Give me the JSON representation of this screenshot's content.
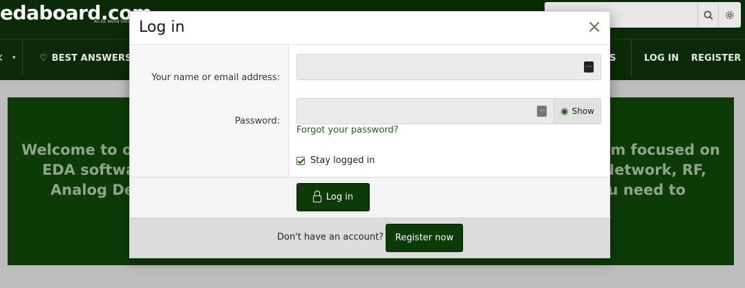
{
  "site": {
    "logo_text": "edaboard.com",
    "logo_tagline": "An EE World Online"
  },
  "header": {
    "search_icon": "search-icon",
    "settings_icon": "gear-icon"
  },
  "nav": {
    "back_glyph": "‹",
    "best_answers": "BEST ANSWERS",
    "dots": "S",
    "login": "LOG IN",
    "register": "REGISTER"
  },
  "welcome": {
    "line1_left": "Welcome to ou",
    "line1_right": "rum focused on",
    "line2_left": "EDA softwa",
    "line2_right": "Network, RF,",
    "line3_left": "Analog Des",
    "line3_right": "you need to"
  },
  "dialog": {
    "title": "Log in",
    "close": "×",
    "username_label": "Your name or email address:",
    "username_value": "",
    "password_label": "Password:",
    "password_value": "",
    "show_label": "Show",
    "forgot_label": "Forgot your password?",
    "stay_label": "Stay logged in",
    "stay_checked": true,
    "login_label": "Log in",
    "no_account_text": "Don't have an account?",
    "register_label": "Register now"
  },
  "colors": {
    "brand_dark": "#0d3b07",
    "header_bg": "#0b2a07",
    "link_green": "#1c6618"
  }
}
